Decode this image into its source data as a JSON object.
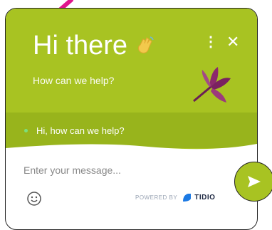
{
  "header": {
    "title": "Hi there",
    "subtitle": "How can we help?",
    "options_icon": "vertical-dots-icon",
    "close_icon": "close-icon",
    "wave_icon": "waving-hand-icon"
  },
  "conversation": {
    "preview_message": "Hi, how can we help?"
  },
  "composer": {
    "placeholder": "Enter your message...",
    "emoji_icon": "emoji-icon",
    "send_icon": "send-icon"
  },
  "footer": {
    "powered_by": "POWERED BY",
    "brand": "TIDIO"
  },
  "colors": {
    "accent": "#a8c322",
    "band": "#98b41c",
    "arrow": "#e0168c"
  }
}
